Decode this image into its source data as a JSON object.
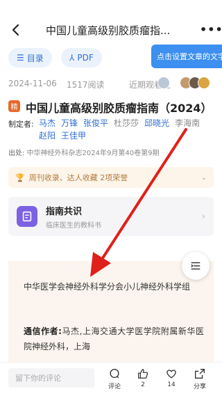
{
  "header": {
    "title": "中国儿童高级别胶质瘤指...",
    "more": "•••"
  },
  "toolbar": {
    "toc_label": "目录",
    "pdf_label": "PDF",
    "tooltip": "点击设置文章的文字"
  },
  "meta": {
    "date": "2024-11-06",
    "reads": "1517阅读",
    "recent_viewers": "近期观看过"
  },
  "article": {
    "tag": "精",
    "title": "中国儿童高级别胶质瘤指南（2024）",
    "authors_label": "制定者:",
    "authors": [
      {
        "name": "马杰",
        "linked": true
      },
      {
        "name": "万锋",
        "linked": true
      },
      {
        "name": "张俊平",
        "linked": true
      },
      {
        "name": "杜莎莎",
        "linked": false
      },
      {
        "name": "邱晓光",
        "linked": true
      },
      {
        "name": "李海南",
        "linked": false
      },
      {
        "name": "赵阳",
        "linked": true
      },
      {
        "name": "王佳甲",
        "linked": true
      }
    ],
    "source_label": "出处:",
    "source": "中华神经外科杂志2024年9月第40卷第9期"
  },
  "honors": {
    "text": "周刊收录、达人收藏 2项荣誉"
  },
  "guide": {
    "title": "指南共识",
    "subtitle": "临床医生的教科书"
  },
  "content": {
    "para1": "中华医学会神经外科学分会小儿神经外科学组",
    "para2_label": "通信作者:",
    "para2_text": "马杰,上海交通大学医学院附属新华医院神经外科，上海"
  },
  "bottom": {
    "comment_placeholder": "留下你的评论",
    "comment_label": "评论",
    "like_count": "2",
    "fav_count": "14",
    "share_label": "分享"
  },
  "colors": {
    "accent": "#2f6fd6",
    "tooltip": "#3d8ff0",
    "tag": "#e8692d",
    "guide_icon": "#7c62e3",
    "arrow": "#e0201a"
  },
  "icons": [
    "back-icon",
    "more-icon",
    "list-icon",
    "pdf-icon",
    "trophy-icon",
    "document-icon",
    "toc-icon",
    "comment-icon",
    "like-icon",
    "heart-icon",
    "share-icon"
  ]
}
